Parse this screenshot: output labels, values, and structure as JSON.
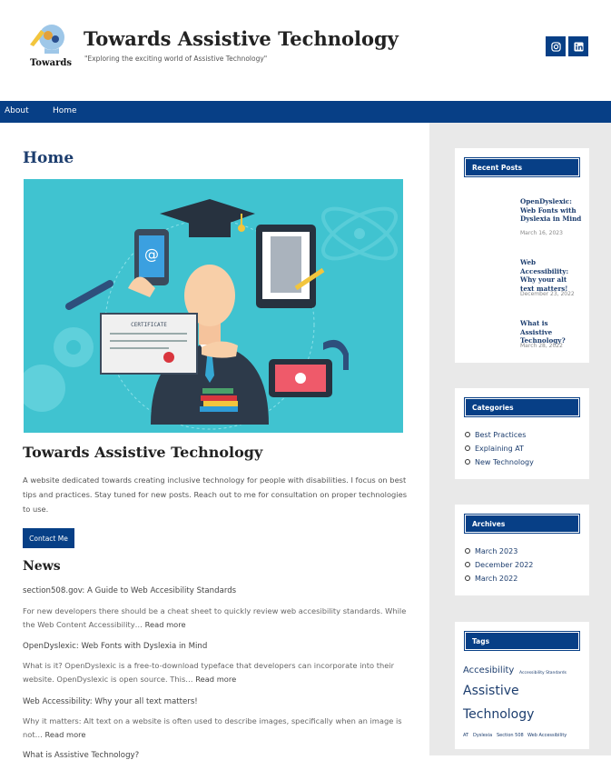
{
  "header": {
    "logo_text": "Towards",
    "title": "Towards Assistive Technology",
    "tagline": "\"Exploring the exciting world of Assistive Technology\"",
    "social_icons": [
      "instagram-icon",
      "linkedin-icon"
    ]
  },
  "nav": {
    "items": [
      "About",
      "Home"
    ]
  },
  "main": {
    "page_heading": "Home",
    "hero_certificate_label": "CERTIFICATE",
    "section_title": "Towards Assistive Technology",
    "intro": "A website dedicated towards creating inclusive technology for people with disabilities. I focus on best tips and practices. Stay tuned for new posts. Reach out to me for consultation on proper technologies to use.",
    "contact_button": "Contact Me",
    "news_heading": "News",
    "news": [
      {
        "title": "section508.gov: A Guide to Web Accesibility Standards",
        "excerpt": "For new developers there should be a cheat sheet to quickly review web accesibility standards. While the Web Content Accessibility…",
        "read_more": "Read more"
      },
      {
        "title": "OpenDyslexic: Web Fonts with Dyslexia in Mind",
        "excerpt": "What is it? OpenDyslexic is a free-to-download typeface that developers can incorporate into their website. OpenDyslexic is open source. This…",
        "read_more": "Read more"
      },
      {
        "title": "Web Accessibility: Why your all text matters!",
        "excerpt": "Why it matters: Alt text on a website is often used to describe images, specifically when an image is not…",
        "read_more": "Read more"
      },
      {
        "title": "What is Assistive Technology?"
      }
    ]
  },
  "sidebar": {
    "recent_posts": {
      "title": "Recent Posts",
      "items": [
        {
          "title": "OpenDyslexic: Web Fonts with Dyslexia in Mind",
          "date": "March 16, 2023"
        },
        {
          "title": "Web Accessibility: Why your alt text matters!",
          "date": "December 23, 2022"
        },
        {
          "title": "What is Assistive Technology?",
          "date": "March 28, 2022"
        }
      ]
    },
    "categories": {
      "title": "Categories",
      "items": [
        "Best Practices",
        "Explaining AT",
        "New Technology"
      ]
    },
    "archives": {
      "title": "Archives",
      "items": [
        "March 2023",
        "December 2022",
        "March 2022"
      ]
    },
    "tags": {
      "title": "Tags",
      "items": [
        "Accesibility",
        "Accessibility Standards",
        "Assistive",
        "Technology",
        "AT",
        "Dyslexia",
        "Section 508",
        "Web Accessibility"
      ]
    }
  },
  "colors": {
    "brand": "#073f86",
    "sidebar_bg": "#e9e9e9",
    "hero_bg": "#40c3d0"
  }
}
